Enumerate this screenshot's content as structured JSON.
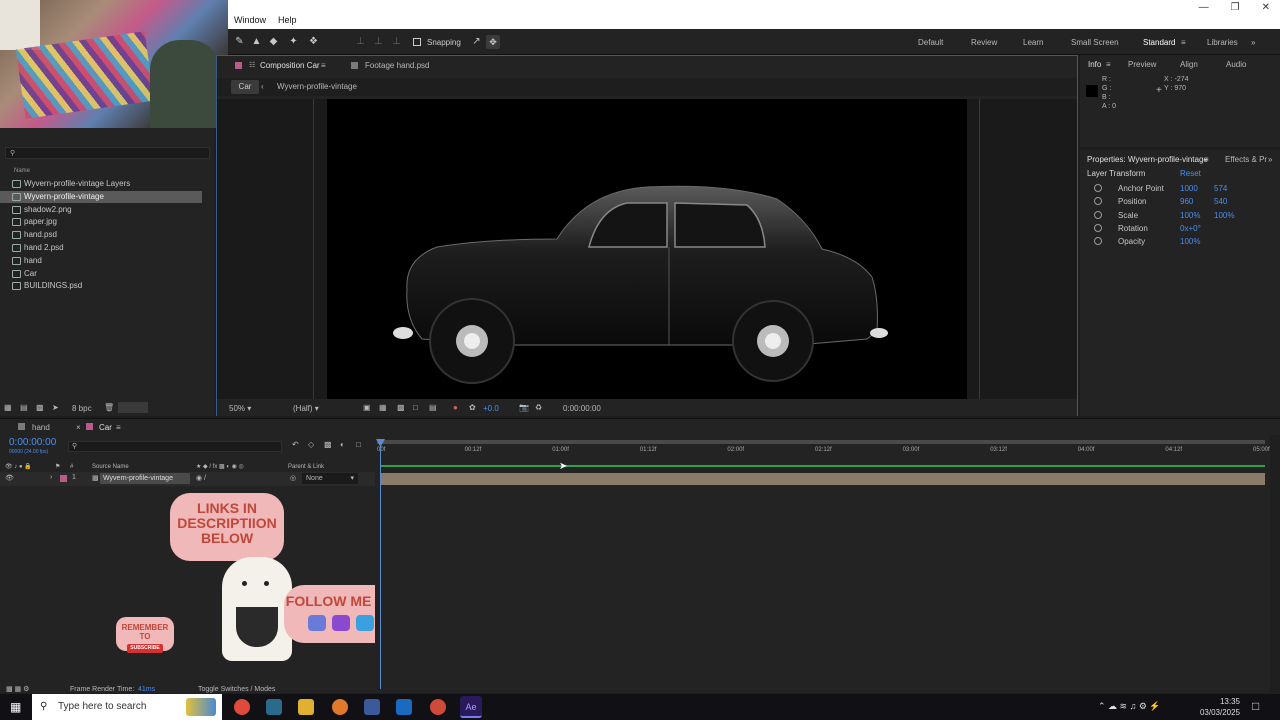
{
  "menu": [
    "Window",
    "Help"
  ],
  "toolbar": {
    "snapping_label": "Snapping"
  },
  "workspaces": [
    {
      "label": "Default",
      "active": false
    },
    {
      "label": "Review",
      "active": false
    },
    {
      "label": "Learn",
      "active": false
    },
    {
      "label": "Small Screen",
      "active": false
    },
    {
      "label": "Standard",
      "active": true
    },
    {
      "label": "Libraries",
      "active": false
    }
  ],
  "project": {
    "search_placeholder": "",
    "column_name": "Name",
    "items": [
      {
        "label": "Wyvern-profile-vintage Layers",
        "type": "folder",
        "selected": false
      },
      {
        "label": "Wyvern-profile-vintage",
        "type": "comp",
        "selected": true
      },
      {
        "label": "shadow2.png",
        "type": "image",
        "selected": false
      },
      {
        "label": "paper.jpg",
        "type": "image",
        "selected": false
      },
      {
        "label": "hand.psd",
        "type": "file",
        "selected": false
      },
      {
        "label": "hand 2.psd",
        "type": "file",
        "selected": false
      },
      {
        "label": "hand",
        "type": "comp",
        "selected": false
      },
      {
        "label": "Car",
        "type": "comp",
        "selected": false
      },
      {
        "label": "BUILDINGS.psd",
        "type": "file",
        "selected": false
      }
    ],
    "bpc": "8 bpc"
  },
  "comp": {
    "tab_comp": "Composition Car",
    "tab_footage": "Footage hand.psd",
    "crumb_1": "Car",
    "crumb_2": "Wyvern-profile-vintage",
    "zoom": "50%",
    "resolution": "(Half)",
    "exposure": "+0.0",
    "timecode": "0:00:00:00"
  },
  "info": {
    "tabs": [
      "Info",
      "Preview",
      "Align",
      "Audio"
    ],
    "r": "R :",
    "g": "G :",
    "b": "B :",
    "a": "A : 0",
    "x": "X : -274",
    "y": "Y : 970"
  },
  "properties": {
    "title": "Properties: Wyvern-profile-vintage",
    "tab2": "Effects & Pr",
    "section": "Layer Transform",
    "reset": "Reset",
    "rows": [
      {
        "name": "Anchor Point",
        "v1": "1000",
        "v2": "574"
      },
      {
        "name": "Position",
        "v1": "960",
        "v2": "540"
      },
      {
        "name": "Scale",
        "v1": "100%",
        "v2": "100%"
      },
      {
        "name": "Rotation",
        "v1": "0x+0°",
        "v2": ""
      },
      {
        "name": "Opacity",
        "v1": "100%",
        "v2": ""
      }
    ]
  },
  "timeline": {
    "tab_hand": "hand",
    "tab_car": "Car",
    "timecode": "0:00:00:00",
    "fps": "00000 (24.00 fps)",
    "col_num": "#",
    "col_source": "Source Name",
    "col_parent": "Parent & Link",
    "layer_num": "1",
    "layer_name": "Wyvern-profile-vintage",
    "parent_value": "None",
    "ruler": [
      "00f",
      "00:12f",
      "01:00f",
      "01:12f",
      "02:00f",
      "02:12f",
      "03:00f",
      "03:12f",
      "04:00f",
      "04:12f",
      "05:00f"
    ],
    "render_time_label": "Frame Render Time:",
    "render_time_value": "41ms",
    "toggle_label": "Toggle Switches / Modes"
  },
  "overlay": {
    "links": "LINKS IN DESCRIPTIION BELOW",
    "follow": "FOLLOW ME ON",
    "remember": "REMEMBER TO",
    "subscribe": "SUBSCRIBE"
  },
  "taskbar": {
    "search_placeholder": "Type here to search",
    "time": "13:35",
    "date": "03/03/2025"
  }
}
